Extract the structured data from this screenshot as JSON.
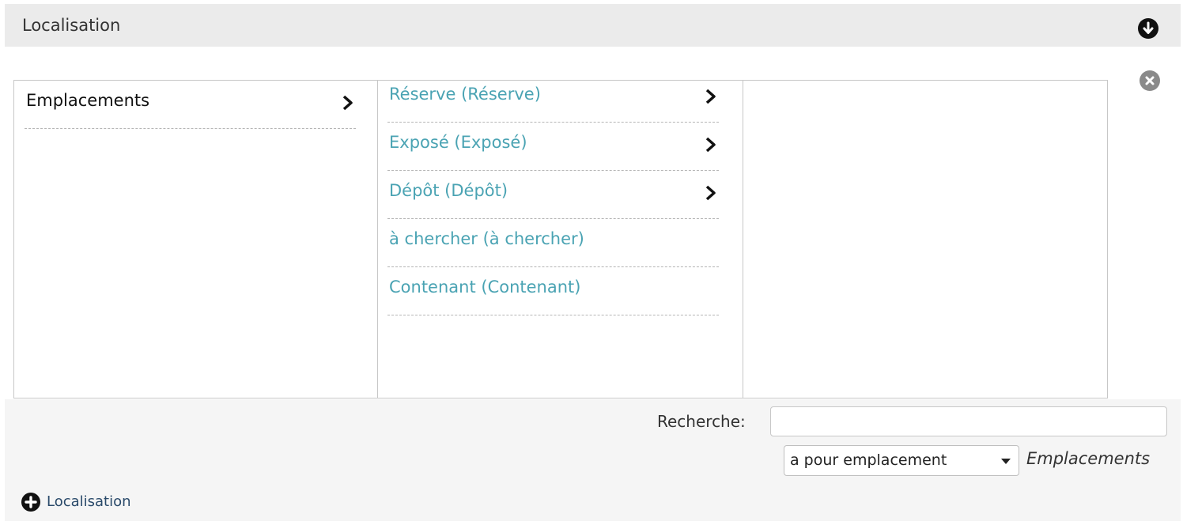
{
  "panel": {
    "title": "Localisation",
    "collapse_icon": "arrow-down-circle-icon",
    "remove_icon": "close-circle-icon"
  },
  "browser": {
    "column1": [
      {
        "label": "Emplacements",
        "has_children": true
      }
    ],
    "column2": [
      {
        "label": "Réserve (Réserve)",
        "has_children": true
      },
      {
        "label": "Exposé (Exposé)",
        "has_children": true
      },
      {
        "label": "Dépôt (Dépôt)",
        "has_children": true
      },
      {
        "label": "à chercher (à chercher)",
        "has_children": false
      },
      {
        "label": "Contenant (Contenant)",
        "has_children": false
      }
    ],
    "link_color": "#4aa3b3"
  },
  "search": {
    "label": "Recherche:",
    "value": "",
    "placeholder": ""
  },
  "relation": {
    "selected": "a pour emplacement",
    "note": "Emplacements"
  },
  "footer": {
    "add_label": "Localisation",
    "add_icon": "plus-circle-icon"
  }
}
